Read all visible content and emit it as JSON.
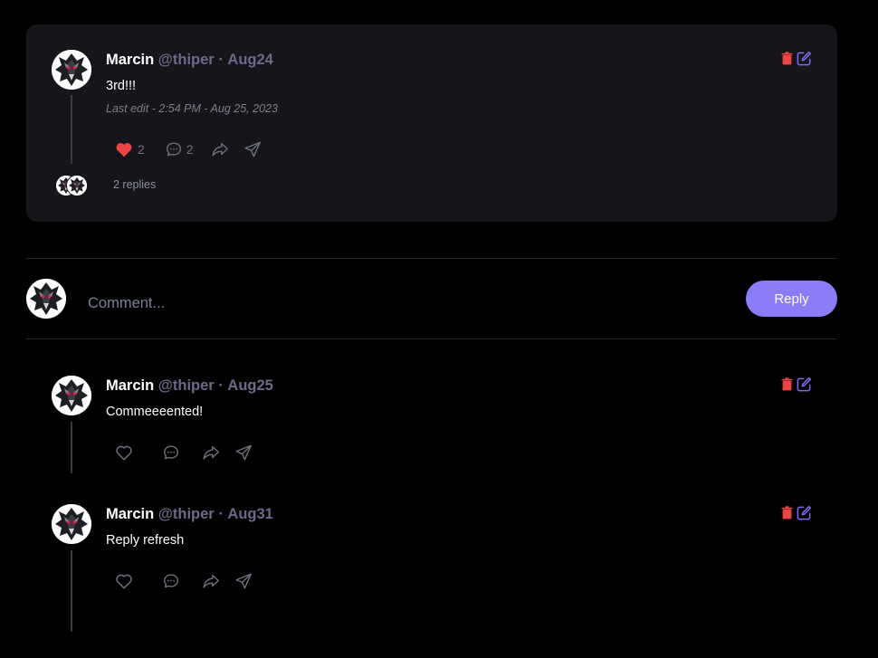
{
  "colors": {
    "background": "#000000",
    "card": "#15151a",
    "accent": "#8b7df8",
    "handle": "#6c6a8c",
    "heart_liked": "#ef4444",
    "delete_icon": "#ef4444",
    "edit_icon": "#7c6cf0",
    "icon_muted": "#6e7280"
  },
  "main_comment": {
    "author": "Marcin",
    "handle": "@thiper",
    "separator": "·",
    "date": "Aug24",
    "text": "3rd!!!",
    "edited": "Last edit - 2:54 PM - Aug 25, 2023",
    "likes": "2",
    "liked": true,
    "comments": "2",
    "replies_label": "2 replies"
  },
  "composer": {
    "placeholder": "Comment...",
    "reply_label": "Reply"
  },
  "replies": [
    {
      "author": "Marcin",
      "handle": "@thiper",
      "separator": "·",
      "date": "Aug25",
      "text": "Commeeeented!"
    },
    {
      "author": "Marcin",
      "handle": "@thiper",
      "separator": "·",
      "date": "Aug31",
      "text": "Reply refresh"
    }
  ],
  "icons": {
    "avatar": "wolf-medallion-icon",
    "like": "heart-icon",
    "comment": "chat-bubble-icon",
    "share": "forward-arrow-icon",
    "send": "paper-plane-icon",
    "delete": "trash-icon",
    "edit": "edit-pencil-icon"
  }
}
